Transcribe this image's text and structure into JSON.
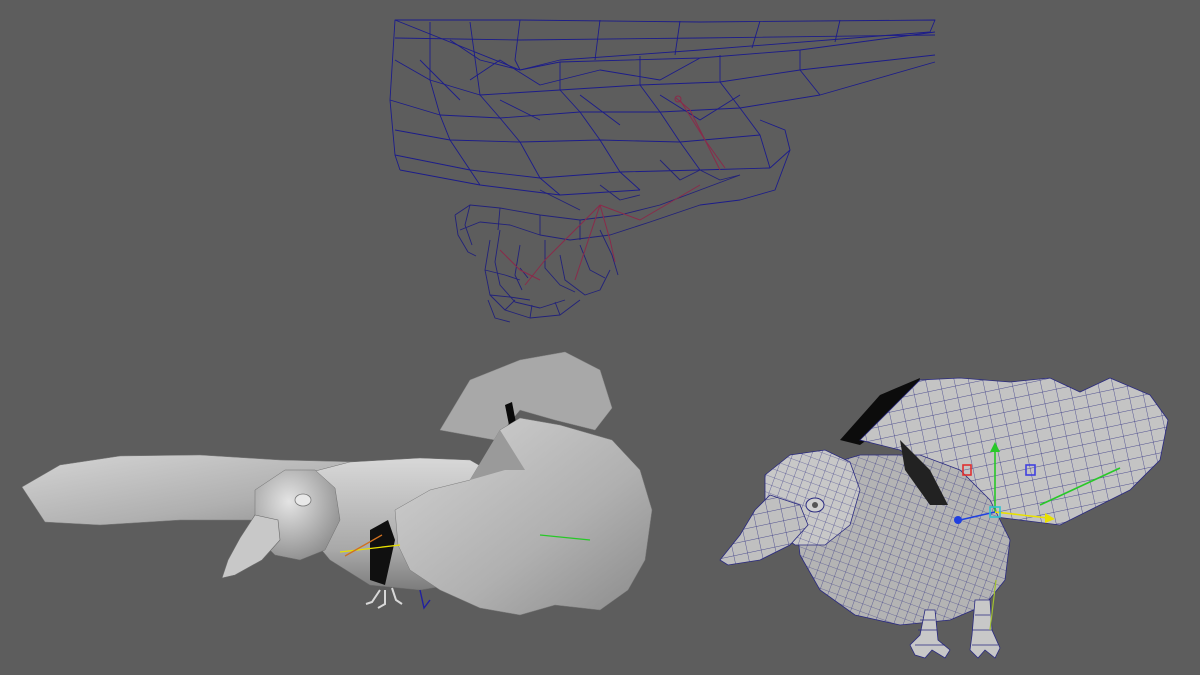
{
  "viewport": {
    "background": "#5d5d5d",
    "wireframe_color": "#1c1c8a",
    "skeleton_color": "#8a2a4a",
    "shaded_color": "#b8b8b8",
    "wire_overlay_color": "#2a2a80"
  },
  "views": [
    {
      "name": "wireframe-talon-closeup",
      "display_mode": "wireframe"
    },
    {
      "name": "shaded-bird",
      "display_mode": "smooth-shaded"
    },
    {
      "name": "wireframe-on-shaded-bird",
      "display_mode": "wireframe-on-shaded"
    }
  ],
  "manipulator": {
    "axes": [
      {
        "axis": "x",
        "color": "#e8e000"
      },
      {
        "axis": "y",
        "color": "#28c828"
      },
      {
        "axis": "z",
        "color": "#2040e0"
      }
    ]
  }
}
